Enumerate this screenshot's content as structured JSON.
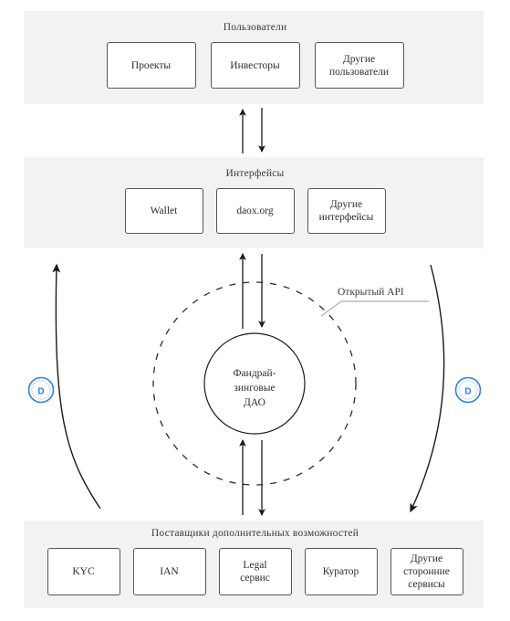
{
  "diagram": {
    "title_text_color": "#3a3a3a",
    "band_background": "#f2f2f2",
    "accent_color": "#2f7fe0",
    "bands": [
      {
        "id": "users",
        "title": "Пользователи",
        "boxes": [
          {
            "label": "Проекты"
          },
          {
            "label": "Инвесторы"
          },
          {
            "label": "Другие\nпользователи"
          }
        ]
      },
      {
        "id": "interfaces",
        "title": "Интерфейсы",
        "boxes": [
          {
            "label": "Wallet"
          },
          {
            "label": "daox.org"
          },
          {
            "label": "Другие\nинтерфейсы"
          }
        ]
      },
      {
        "id": "providers",
        "title": "Поставщики дополнительных возможностей",
        "boxes": [
          {
            "label": "KYC"
          },
          {
            "label": "IAN"
          },
          {
            "label": "Legal\nсервис"
          },
          {
            "label": "Куратор"
          },
          {
            "label": "Другие\nсторонние\nсервисы"
          }
        ]
      }
    ],
    "center": {
      "line1": "Фандрай-",
      "line2": "зинговые",
      "line3": "ДАО"
    },
    "annotation": {
      "label": "Открытый API"
    },
    "badges": {
      "left_glyph": "D",
      "right_glyph": "D"
    }
  }
}
